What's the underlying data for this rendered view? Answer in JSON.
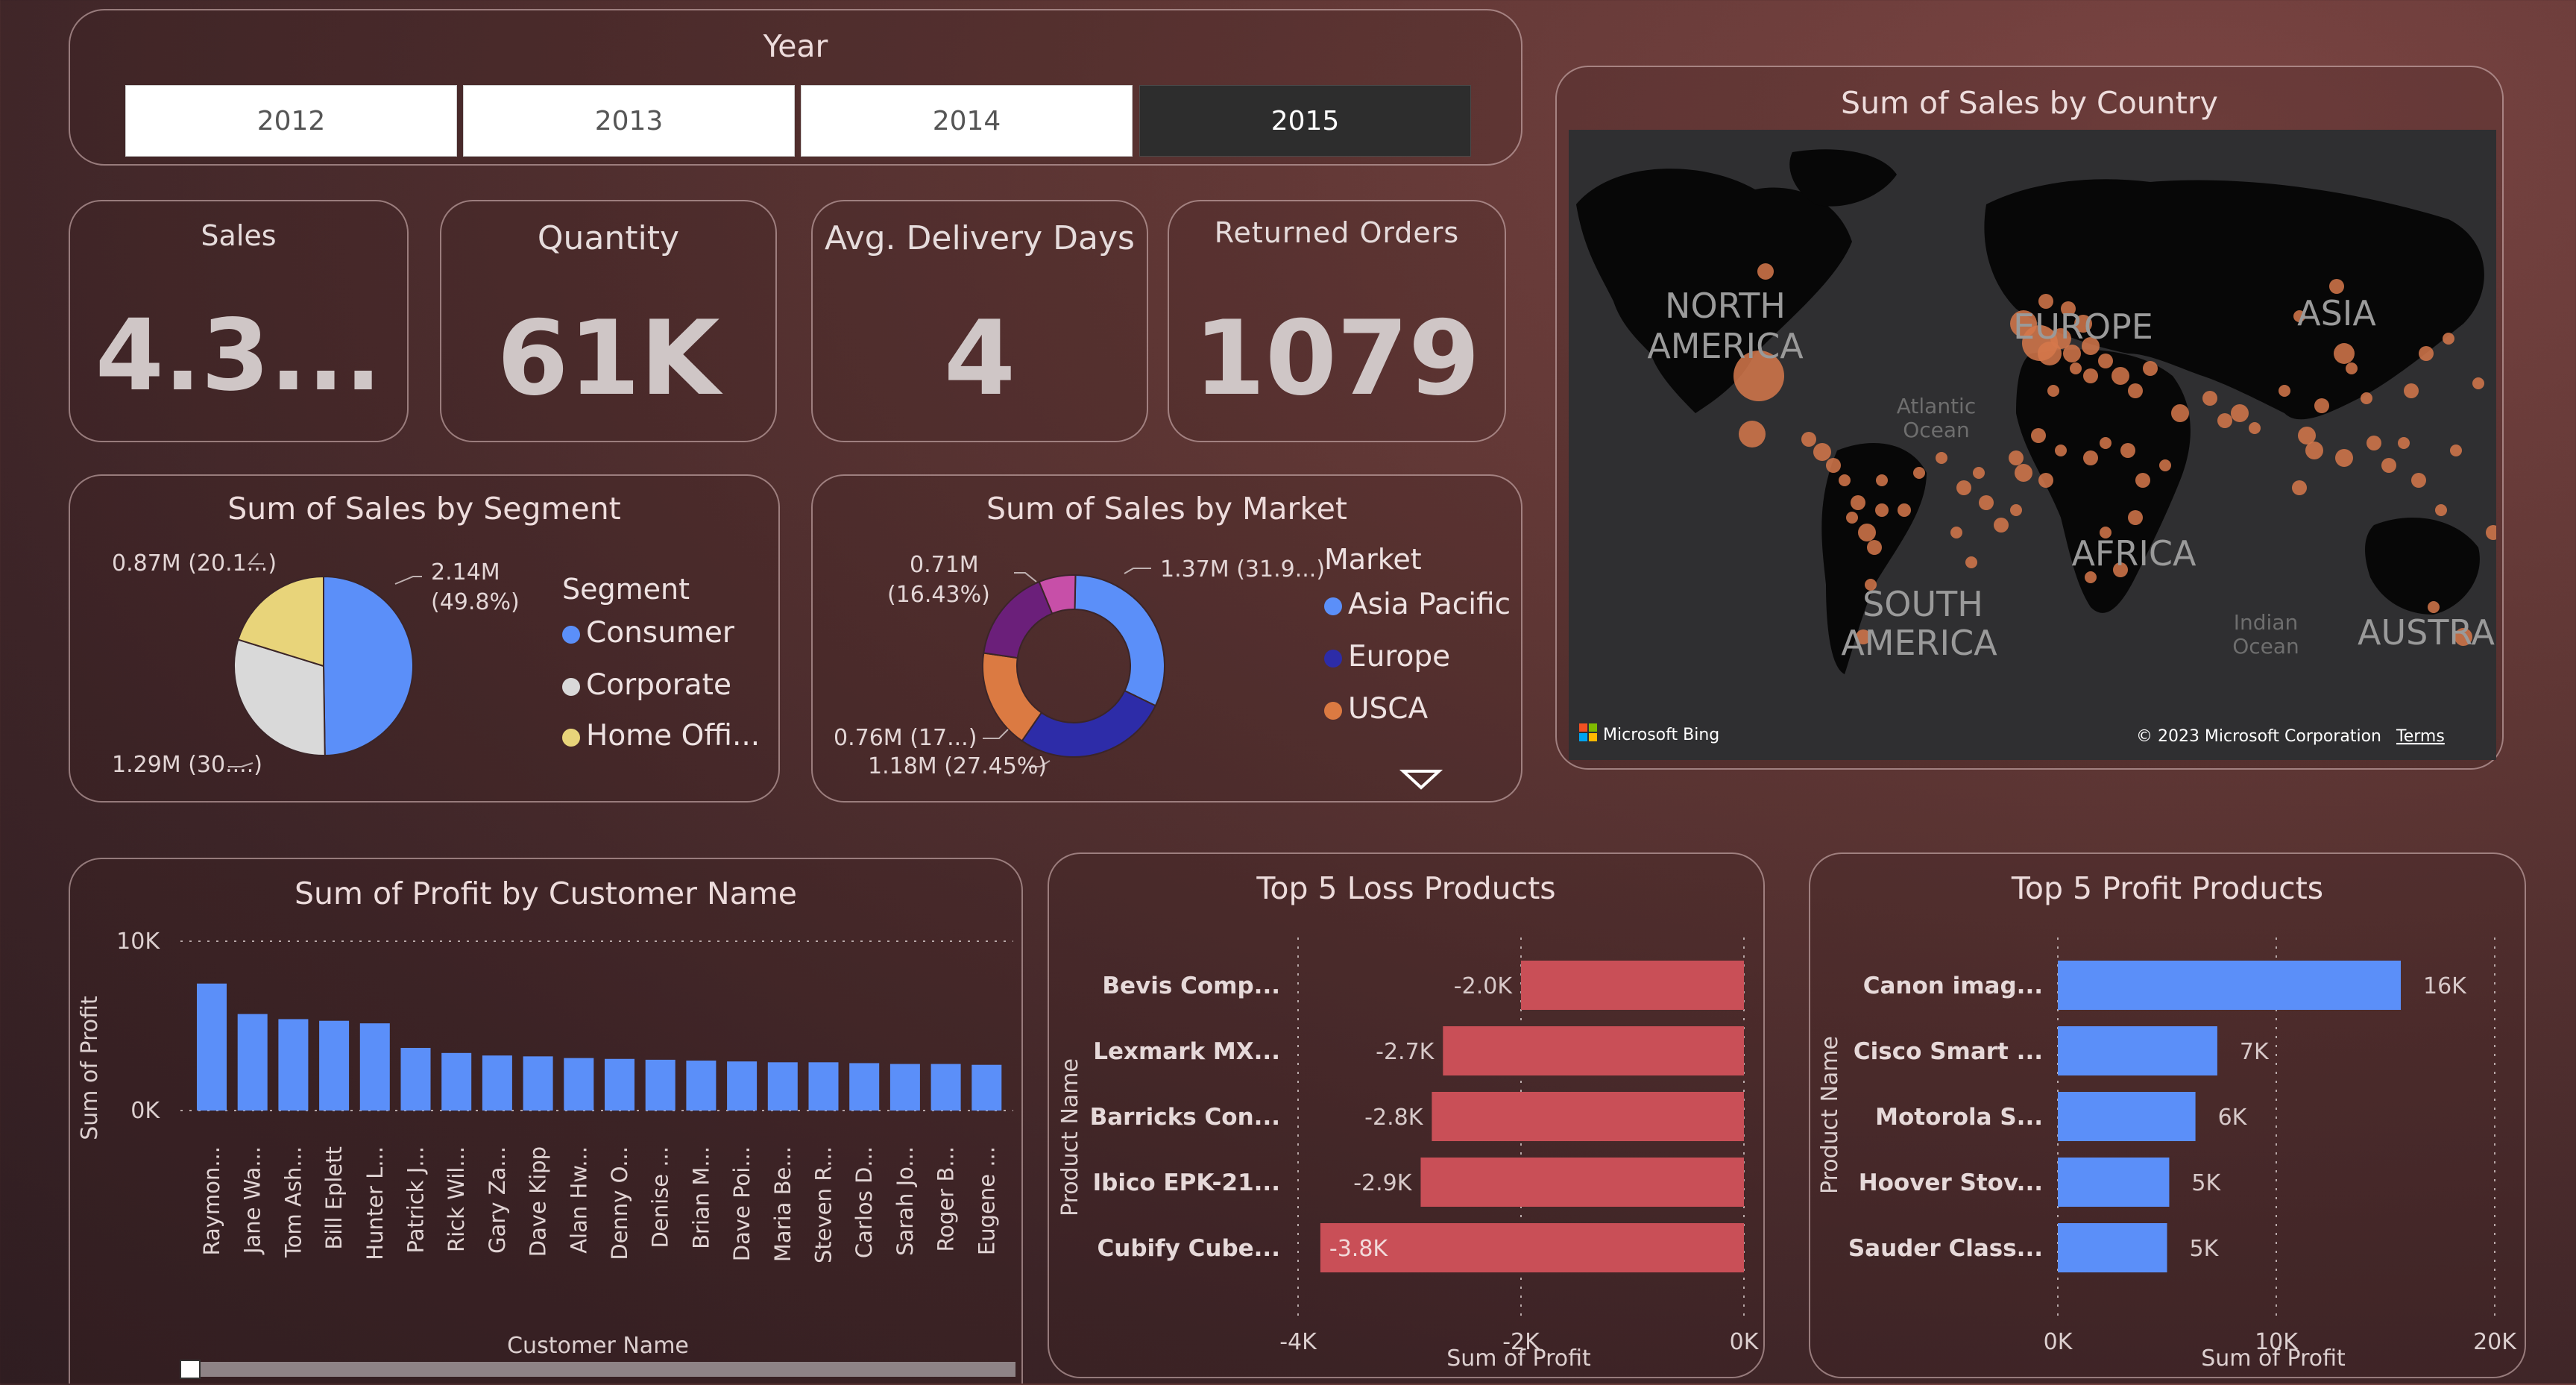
{
  "year_slicer": {
    "title": "Year",
    "options": [
      "2012",
      "2013",
      "2014",
      "2015"
    ],
    "selected": "2015"
  },
  "kpis": {
    "sales": {
      "label": "Sales",
      "value": "4.3..."
    },
    "quantity": {
      "label": "Quantity",
      "value": "61K"
    },
    "delivery": {
      "label": "Avg. Delivery Days",
      "value": "4"
    },
    "returned": {
      "label": "Returned Orders",
      "value": "1079"
    }
  },
  "segment_chart": {
    "title": "Sum of Sales by Segment",
    "legend_title": "Segment",
    "legend": [
      "Consumer",
      "Corporate",
      "Home Offi..."
    ],
    "colors": {
      "Consumer": "#5b8ff9",
      "Corporate": "#d9d9d9",
      "Home Office": "#e8d47a"
    },
    "labels": {
      "consumer": [
        "2.14M",
        "(49.8%)"
      ],
      "corporate": "1.29M (30....)",
      "home_office": "0.87M (20.1...)"
    }
  },
  "market_chart": {
    "title": "Sum of Sales by Market",
    "legend_title": "Market",
    "legend": [
      "Asia Pacific",
      "Europe",
      "USCA"
    ],
    "colors": {
      "Asia Pacific": "#5b8ff9",
      "Europe": "#2d2ca8",
      "USCA": "#db7a42",
      "Other1": "#6b1f7a",
      "Other2": "#c74fa8"
    },
    "labels": {
      "asia": "1.37M (31.9...)",
      "europe": "1.18M (27.45%)",
      "usca": "0.76M (17...)",
      "top": [
        "0.71M",
        "(16.43%)"
      ]
    }
  },
  "map": {
    "title": "Sum of Sales by Country",
    "labels": {
      "north_america": [
        "NORTH",
        "AMERICA"
      ],
      "europe": "EUROPE",
      "asia": "ASIA",
      "africa": "AFRICA",
      "south_america": [
        "SOUTH",
        "AMERICA"
      ],
      "australia": "AUSTRA",
      "atlantic": [
        "Atlantic",
        "Ocean"
      ],
      "indian": [
        "Indian",
        "Ocean"
      ]
    },
    "bing": "Microsoft Bing",
    "copyright": "© 2023 Microsoft Corporation",
    "terms": "Terms",
    "bubble_color": "#d6784b"
  },
  "profit_customer": {
    "title": "Sum of Profit by Customer Name",
    "xlabel": "Customer Name",
    "ylabel": "Sum of Profit",
    "ticks": [
      "10K",
      "0K"
    ],
    "bar_color": "#5b8ff9"
  },
  "loss_products": {
    "title": "Top 5 Loss Products",
    "ylabel": "Product Name",
    "xlabel": "Sum of Profit",
    "ticks": [
      "-4K",
      "-2K",
      "0K"
    ],
    "bar_color": "#c94f57"
  },
  "profit_products": {
    "title": "Top 5 Profit Products",
    "ylabel": "Product Name",
    "xlabel": "Sum of Profit",
    "ticks": [
      "0K",
      "10K",
      "20K"
    ],
    "bar_color": "#5b8ff9"
  },
  "chart_data": [
    {
      "type": "pie",
      "title": "Sum of Sales by Segment",
      "categories": [
        "Consumer",
        "Corporate",
        "Home Office"
      ],
      "values": [
        2.14,
        1.29,
        0.87
      ],
      "percent": [
        49.8,
        30.1,
        20.1
      ]
    },
    {
      "type": "pie",
      "title": "Sum of Sales by Market",
      "categories": [
        "Asia Pacific",
        "Europe",
        "USCA",
        "",
        ""
      ],
      "values": [
        1.37,
        1.18,
        0.76,
        0.71,
        0.28
      ],
      "percent": [
        31.9,
        27.45,
        17.6,
        16.43,
        6.5
      ]
    },
    {
      "type": "bar",
      "title": "Sum of Profit by Customer Name",
      "categories": [
        "Raymon...",
        "Jane Wa...",
        "Tom Ash...",
        "Bill Eplett",
        "Hunter L...",
        "Patrick J...",
        "Rick Wil...",
        "Gary Za...",
        "Dave Kipp",
        "Alan Hw...",
        "Denny O...",
        "Denise ...",
        "Brian M...",
        "Dave Poi...",
        "Maria Be...",
        "Steven R...",
        "Carlos D...",
        "Sarah Jo...",
        "Roger B...",
        "Eugene ..."
      ],
      "values": [
        7500,
        5700,
        5400,
        5300,
        5150,
        3700,
        3400,
        3250,
        3200,
        3100,
        3050,
        3000,
        2950,
        2900,
        2850,
        2850,
        2800,
        2750,
        2750,
        2700
      ],
      "ylim": [
        0,
        10000
      ],
      "xlabel": "Customer Name",
      "ylabel": "Sum of Profit"
    },
    {
      "type": "bar",
      "title": "Top 5 Loss Products",
      "categories": [
        "Bevis Comp...",
        "Lexmark MX...",
        "Barricks Con...",
        "Ibico EPK-21...",
        "Cubify Cube..."
      ],
      "values": [
        -2000,
        -2700,
        -2800,
        -2900,
        -3800
      ],
      "value_labels": [
        "-2.0K",
        "-2.7K",
        "-2.8K",
        "-2.9K",
        "-3.8K"
      ],
      "xlim": [
        -4000,
        0
      ],
      "xlabel": "Sum of Profit",
      "ylabel": "Product Name"
    },
    {
      "type": "bar",
      "title": "Top 5 Profit Products",
      "categories": [
        "Canon imag...",
        "Cisco Smart ...",
        "Motorola S...",
        "Hoover Stov...",
        "Sauder Class..."
      ],
      "values": [
        15700,
        7300,
        6300,
        5100,
        5000
      ],
      "value_labels": [
        "16K",
        "7K",
        "6K",
        "5K",
        "5K"
      ],
      "xlim": [
        0,
        20000
      ],
      "xlabel": "Sum of Profit",
      "ylabel": "Product Name"
    }
  ]
}
